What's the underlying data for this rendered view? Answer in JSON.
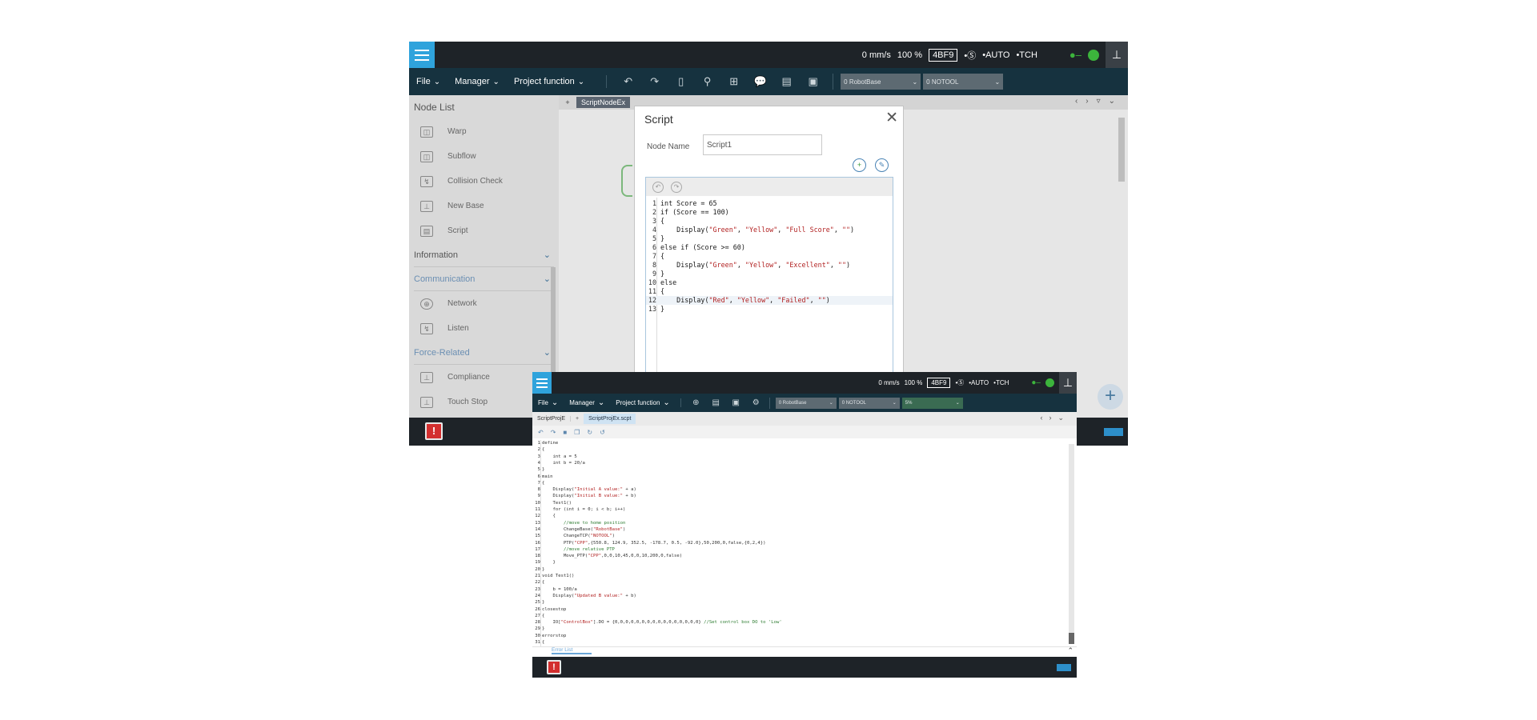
{
  "status": {
    "speed": "0 mm/s",
    "percent": "100 %",
    "code": "4BF9",
    "mode_auto": "•AUTO",
    "mode_tch": "•TCH",
    "mode_s": "•Ⓢ"
  },
  "menu": {
    "file": "File",
    "manager": "Manager",
    "project_function": "Project function"
  },
  "dropdowns": {
    "robot_base": "0 RobotBase",
    "tool": "0 NOTOOL",
    "speed_pct": "5%"
  },
  "node_list": {
    "title": "Node List",
    "items": [
      "Warp",
      "Subflow",
      "Collision Check",
      "New Base",
      "Script"
    ],
    "sections": [
      "Information",
      "Communication",
      "Force-Related"
    ],
    "comm_items": [
      "Network",
      "Listen"
    ],
    "force_items": [
      "Compliance",
      "Touch Stop"
    ]
  },
  "canvas_tab": "ScriptNodeEx",
  "dialog": {
    "title": "Script",
    "node_name_label": "Node Name",
    "node_name_value": "Script1",
    "lines": [
      "int Score = 65",
      "if (Score == 100)",
      "{",
      "    Display(\"Green\", \"Yellow\", \"Full Score\", \"\")",
      "}",
      "else if (Score >= 60)",
      "{",
      "    Display(\"Green\", \"Yellow\", \"Excellent\", \"\")",
      "}",
      "else",
      "{",
      "    Display(\"Red\", \"Yellow\", \"Failed\", \"\")",
      "}"
    ]
  },
  "editor2": {
    "tab1": "ScriptProjE",
    "tab2": "ScriptProjEx.scpt",
    "error_list": "Error List",
    "lines": [
      "define",
      "{",
      "    int a = 5",
      "    int b = 20/a",
      "}",
      "main",
      "{",
      "    Display(\"Initial A value:\" + a)",
      "    Display(\"Initial B value:\" + b)",
      "    Test1()",
      "    for (int i = 0; i < b; i++)",
      "    {",
      "        //move to home position",
      "        ChangeBase(\"RobotBase\")",
      "        ChangeTCP(\"NOTOOL\")",
      "        PTP(\"CPP\",{550.8, 124.9, 352.5, -178.7, 0.5, -92.0},50,200,0,false,{0,2,4})",
      "        //move relative PTP",
      "        Move_PTP(\"CPP\",0,0,10,45,0,0,10,200,0,false)",
      "    }",
      "}",
      "void Test1()",
      "{",
      "    b = 100/a",
      "    Display(\"Updated B value:\" + b)",
      "}",
      "closestop",
      "{",
      "    IO[\"ControlBox\"].DO = {0,0,0,0,0,0,0,0,0,0,0,0,0,0,0,0} //Set control box DO to 'Low'",
      "}",
      "errorstop",
      "{"
    ]
  }
}
